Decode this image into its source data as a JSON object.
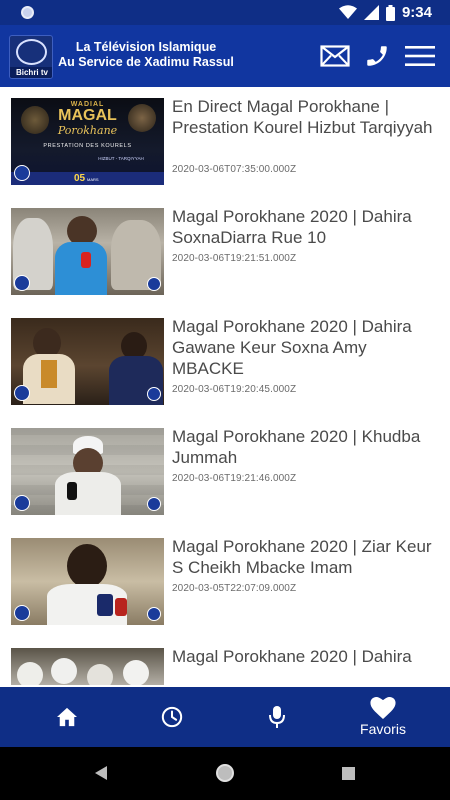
{
  "status_bar": {
    "time": "9:34"
  },
  "app_bar": {
    "logo_text": "Bichri tv",
    "title_line1": "La Télévision Islamique",
    "title_line2": "Au Service de Xadimu Rassul",
    "actions": [
      {
        "icon": "envelope-icon"
      },
      {
        "icon": "phone-icon"
      },
      {
        "icon": "hamburger-menu-icon"
      }
    ]
  },
  "videos": [
    {
      "title": "En Direct Magal Porokhane | Prestation Kourel Hizbut Tarqiyyah",
      "date": "2020-03-06T07:35:00.000Z",
      "thumb_text": {
        "line1": "WADIAL",
        "line2": "MAGAL",
        "line3": "Porokhane",
        "line4": "PRESTATION DES KOURELS",
        "line5": "HIZBUT - TARQIYYAH",
        "day": "05",
        "month": "MARS"
      }
    },
    {
      "title": "Magal Porokhane 2020 | Dahira SoxnaDiarra Rue 10",
      "date": "2020-03-06T19:21:51.000Z"
    },
    {
      "title": "Magal Porokhane 2020 | Dahira Gawane Keur Soxna Amy MBACKE",
      "date": "2020-03-06T19:20:45.000Z"
    },
    {
      "title": "Magal Porokhane 2020 | Khudba Jummah",
      "date": "2020-03-06T19:21:46.000Z"
    },
    {
      "title": "Magal Porokhane 2020 | Ziar Keur S Cheikh Mbacke Imam",
      "date": "2020-03-05T22:07:09.000Z"
    },
    {
      "title": "Magal Porokhane 2020 | Dahira",
      "date": ""
    }
  ],
  "bottom_nav": [
    {
      "icon": "home-icon",
      "label": ""
    },
    {
      "icon": "clock-icon",
      "label": ""
    },
    {
      "icon": "microphone-icon",
      "label": ""
    },
    {
      "icon": "heart-icon",
      "label": "Favoris"
    }
  ]
}
